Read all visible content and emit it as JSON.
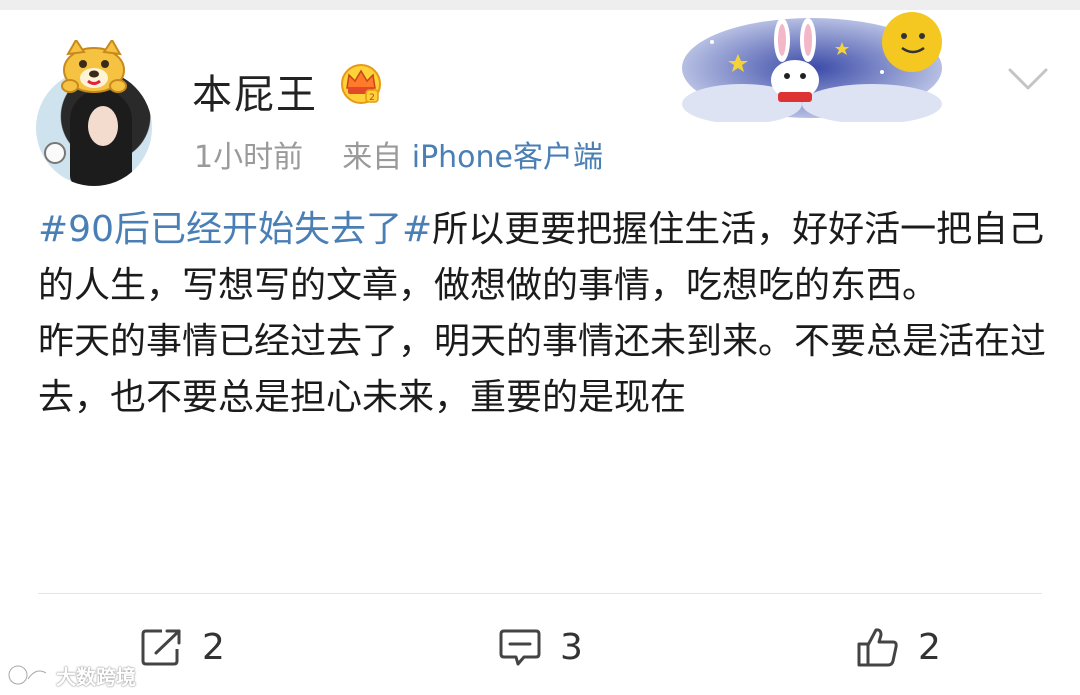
{
  "user": {
    "name": "本屁王",
    "avatar_icon": "user-avatar",
    "badge_icon": "vip-crown-icon"
  },
  "meta": {
    "time": "1小时前",
    "source_prefix": "来自",
    "source": "iPhone客户端"
  },
  "post": {
    "hashtag": "#90后已经开始失去了#",
    "paragraph1_rest": "所以更要把握住生活，好好活一把自己的人生，写想写的文章，做想做的事情，吃想吃的东西。",
    "paragraph2": "昨天的事情已经过去了，明天的事情还未到来。不要总是活在过去，也不要总是担心未来，重要的是现在"
  },
  "actions": {
    "repost_count": "2",
    "comment_count": "3",
    "like_count": "2"
  },
  "watermark": {
    "text": "大数跨境"
  },
  "colors": {
    "link": "#4a7fb5",
    "meta": "#9a9a9a",
    "text": "#1b1b1b"
  }
}
